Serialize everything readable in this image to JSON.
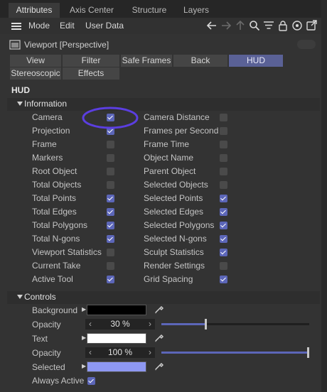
{
  "tabs": [
    "Attributes",
    "Axis Center",
    "Structure",
    "Layers"
  ],
  "menu": [
    "Mode",
    "Edit",
    "User Data"
  ],
  "viewport_title": "Viewport [Perspective]",
  "buttons_row1": [
    "View",
    "Filter",
    "Safe Frames",
    "Back",
    "HUD"
  ],
  "buttons_row2": [
    "Stereoscopic",
    "Effects"
  ],
  "selected_button": "HUD",
  "hud_title": "HUD",
  "information_group": "Information",
  "controls_group": "Controls",
  "information": {
    "left": [
      {
        "label": "Camera",
        "checked": true
      },
      {
        "label": "Projection",
        "checked": true
      },
      {
        "label": "Frame",
        "checked": false
      },
      {
        "label": "Markers",
        "checked": false
      },
      {
        "label": "Root Object",
        "checked": false
      },
      {
        "label": "Total Objects",
        "checked": false
      },
      {
        "label": "Total Points",
        "checked": true
      },
      {
        "label": "Total Edges",
        "checked": true
      },
      {
        "label": "Total Polygons",
        "checked": true
      },
      {
        "label": "Total N-gons",
        "checked": true
      },
      {
        "label": "Viewport Statistics",
        "checked": false
      },
      {
        "label": "Current Take",
        "checked": false
      },
      {
        "label": "Active Tool",
        "checked": true
      }
    ],
    "right": [
      {
        "label": "Camera Distance",
        "checked": false
      },
      {
        "label": "Frames per Second",
        "checked": false
      },
      {
        "label": "Frame Time",
        "checked": false
      },
      {
        "label": "Object Name",
        "checked": false
      },
      {
        "label": "Parent Object",
        "checked": false
      },
      {
        "label": "Selected Objects",
        "checked": false
      },
      {
        "label": "Selected Points",
        "checked": true
      },
      {
        "label": "Selected Edges",
        "checked": true
      },
      {
        "label": "Selected Polygons",
        "checked": true
      },
      {
        "label": "Selected N-gons",
        "checked": true
      },
      {
        "label": "Sculpt Statistics",
        "checked": true
      },
      {
        "label": "Render Settings",
        "checked": false
      },
      {
        "label": "Grid Spacing",
        "checked": true
      }
    ]
  },
  "controls": {
    "background_label": "Background",
    "background_color": "#000000",
    "opacity1_label": "Opacity",
    "opacity1_value": "30 %",
    "opacity1_fraction": 0.3,
    "text_label": "Text",
    "text_color": "#ffffff",
    "opacity2_label": "Opacity",
    "opacity2_value": "100 %",
    "opacity2_fraction": 1.0,
    "selected_label": "Selected",
    "selected_color": "#8e98f2",
    "always_active_label": "Always Active",
    "always_active_checked": true
  },
  "colors": {
    "accent": "#5c66b8",
    "annotation_circle": "#5b3ee0"
  }
}
